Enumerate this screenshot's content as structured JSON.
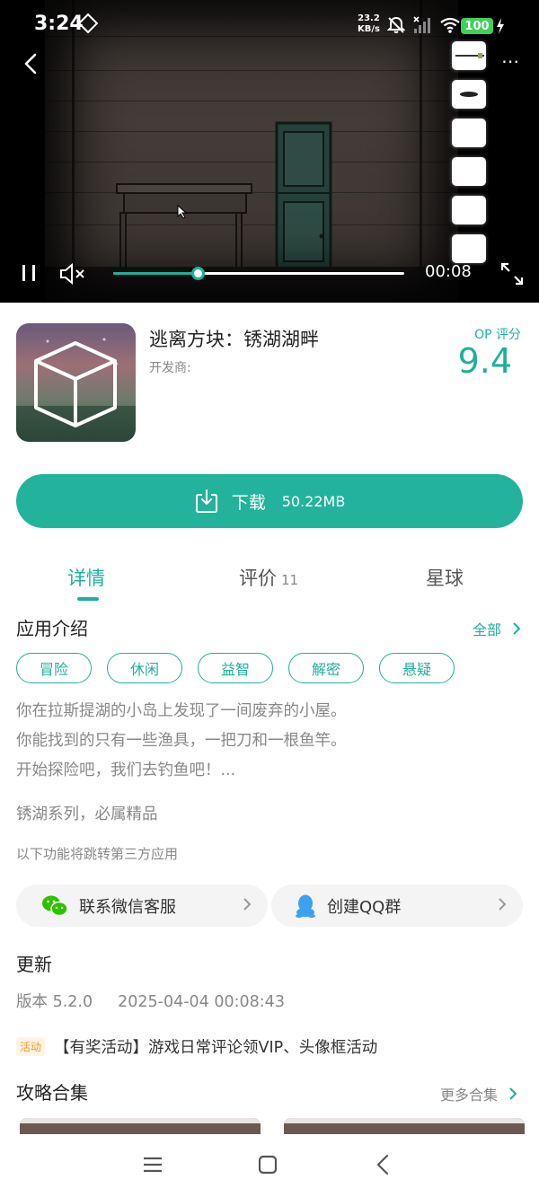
{
  "status_bar": {
    "time": "3:24",
    "net_speed_value": "23.2",
    "net_speed_unit": "KB/s",
    "battery": "100"
  },
  "video": {
    "current_time": "00:08",
    "progress": 0.29,
    "muted": true,
    "inventory_slots": 6
  },
  "app": {
    "title": "逃离方块：锈湖湖畔",
    "developer_label": "开发商:",
    "score_label": "OP 评分",
    "score": "9.4"
  },
  "download": {
    "label": "下载",
    "size": "50.22MB"
  },
  "tabs": [
    {
      "label": "详情",
      "count": ""
    },
    {
      "label": "评价",
      "count": "11"
    },
    {
      "label": "星球",
      "count": ""
    }
  ],
  "intro": {
    "title": "应用介绍",
    "see_all": "全部",
    "tags": [
      "冒险",
      "休闲",
      "益智",
      "解密",
      "悬疑"
    ],
    "description": [
      "你在拉斯提湖的小岛上发现了一间废弃的小屋。",
      "你能找到的只有一些渔具，一把刀和一根鱼竿。",
      "开始探险吧，我们去钓鱼吧！..."
    ],
    "tagline": "锈湖系列，必属精品",
    "third_party_note": "以下功能将跳转第三方应用"
  },
  "contacts": [
    {
      "label": "联系微信客服",
      "icon": "wechat-icon"
    },
    {
      "label": "创建QQ群",
      "icon": "qq-icon"
    }
  ],
  "update": {
    "title": "更新",
    "version": "版本 5.2.0",
    "date": "2025-04-04 00:08:43"
  },
  "activity": {
    "badge": "活动",
    "text": "【有奖活动】游戏日常评论领VIP、头像框活动"
  },
  "guides": {
    "title": "攻略合集",
    "more": "更多合集"
  },
  "colors": {
    "accent": "#1fb09b",
    "download_button": "#23b39d",
    "activity_badge": "#f39a2c"
  }
}
